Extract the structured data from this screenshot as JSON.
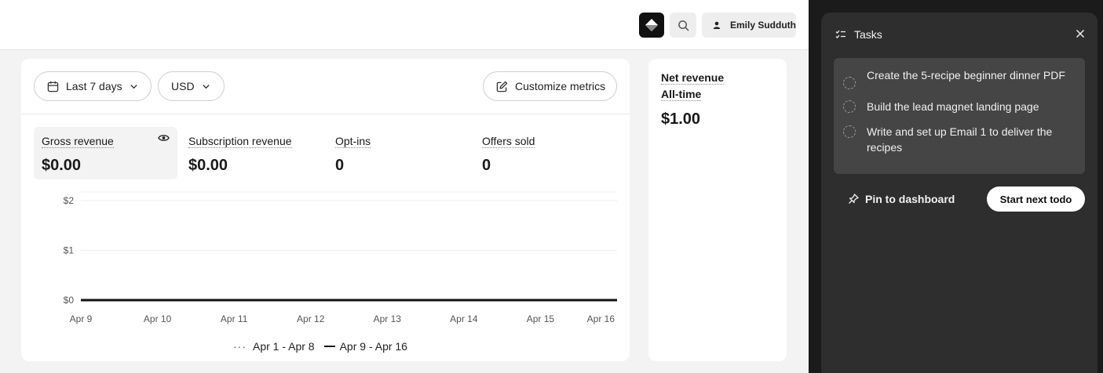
{
  "header": {
    "user_name": "Emily Sudduth"
  },
  "filters": {
    "date_range": "Last 7 days",
    "currency": "USD",
    "customize_label": "Customize metrics"
  },
  "metrics": [
    {
      "label": "Gross revenue",
      "value": "$0.00"
    },
    {
      "label": "Subscription revenue",
      "value": "$0.00"
    },
    {
      "label": "Opt-ins",
      "value": "0"
    },
    {
      "label": "Offers sold",
      "value": "0"
    }
  ],
  "chart_data": {
    "type": "line",
    "x": [
      "Apr 9",
      "Apr 10",
      "Apr 11",
      "Apr 12",
      "Apr 13",
      "Apr 14",
      "Apr 15",
      "Apr 16"
    ],
    "y_ticks": [
      "$2",
      "$1",
      "$0"
    ],
    "ylim": [
      0,
      2
    ],
    "series": [
      {
        "name": "Apr 1 - Apr 8",
        "style": "dotted",
        "values": [
          0,
          0,
          0,
          0,
          0,
          0,
          0,
          0
        ]
      },
      {
        "name": "Apr 9 - Apr 16",
        "style": "solid",
        "values": [
          0,
          0,
          0,
          0,
          0,
          0,
          0,
          0
        ]
      }
    ]
  },
  "side": {
    "label_1": "Net revenue",
    "label_2": "All-time",
    "value": "$1.00"
  },
  "tasks": {
    "title": "Tasks",
    "items": [
      "Create the 5-recipe beginner dinner PDF",
      "Build the lead magnet landing page",
      "Write and set up Email 1 to deliver the recipes"
    ],
    "pin_label": "Pin to dashboard",
    "start_label": "Start next todo"
  }
}
